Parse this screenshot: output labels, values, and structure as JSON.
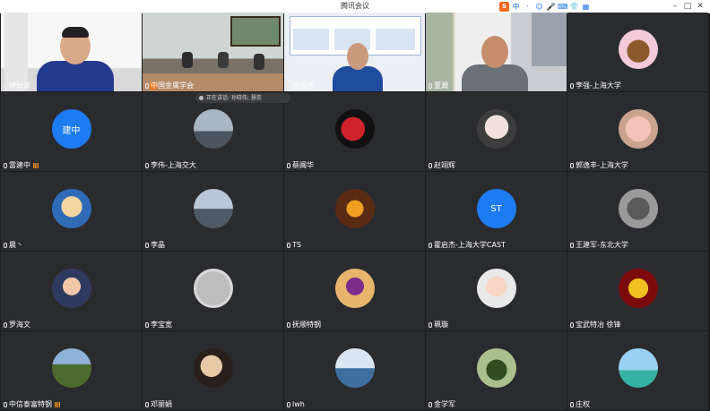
{
  "window": {
    "title": "腾讯会议"
  },
  "toolbar": {
    "ime": "S",
    "icons": [
      "中",
      "·",
      "☺",
      "🎤",
      "⌨",
      "👕",
      "▦"
    ]
  },
  "speaking": {
    "label": "正在讲话: 孙晓伟; 慧蕊"
  },
  "participants": [
    {
      "name": "钟云波",
      "kind": "video"
    },
    {
      "name": "中国金属学会",
      "kind": "video"
    },
    {
      "name": "张成连",
      "kind": "video"
    },
    {
      "name": "董瀚",
      "kind": "video"
    },
    {
      "name": "李强-上海大学",
      "kind": "avatar"
    },
    {
      "name": "雷建中",
      "kind": "avatar",
      "initials": "建中",
      "color": "#1e7cf2"
    },
    {
      "name": "李伟-上海交大",
      "kind": "avatar"
    },
    {
      "name": "蔡闽华",
      "kind": "avatar"
    },
    {
      "name": "赵翊辉",
      "kind": "avatar"
    },
    {
      "name": "郭逸丰-上海大学",
      "kind": "avatar"
    },
    {
      "name": "晨丶",
      "kind": "avatar"
    },
    {
      "name": "李晶",
      "kind": "avatar"
    },
    {
      "name": "TS",
      "kind": "avatar"
    },
    {
      "name": "霍启杰-上海大学CAST",
      "kind": "avatar",
      "initials": "ST",
      "color": "#1e7cf2"
    },
    {
      "name": "王建军-东北大学",
      "kind": "avatar"
    },
    {
      "name": "罗海文",
      "kind": "avatar"
    },
    {
      "name": "李宝宽",
      "kind": "avatar"
    },
    {
      "name": "抚顺特钢",
      "kind": "avatar"
    },
    {
      "name": "珮璇",
      "kind": "avatar"
    },
    {
      "name": "宝武特冶 徐锋",
      "kind": "avatar"
    },
    {
      "name": "中信泰富特钢",
      "kind": "avatar"
    },
    {
      "name": "邓丽娟",
      "kind": "avatar"
    },
    {
      "name": "lwh",
      "kind": "avatar"
    },
    {
      "name": "金学军",
      "kind": "avatar"
    },
    {
      "name": "庄权",
      "kind": "avatar"
    }
  ]
}
